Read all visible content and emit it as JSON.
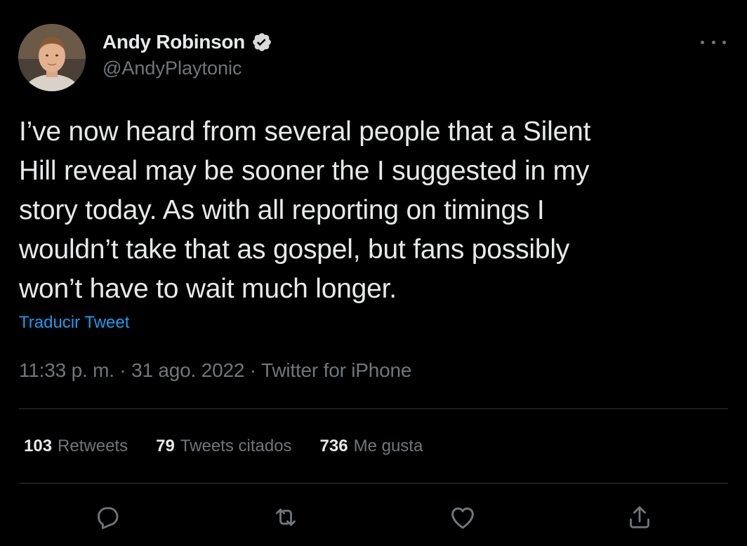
{
  "author": {
    "display_name": "Andy Robinson",
    "handle": "@AndyPlaytonic",
    "verified_icon": "verified-badge-icon"
  },
  "tweet": {
    "text": "I’ve now heard from several people that a Silent\nHill reveal may be sooner the I suggested in my\nstory today. As with all  reporting on timings I\nwouldn’t take that as gospel, but fans possibly\nwon’t have to wait much longer.",
    "translate_label": "Traducir Tweet",
    "time": "11:33 p. m.",
    "date": "31 ago. 2022",
    "source": "Twitter for iPhone",
    "separator": " · "
  },
  "stats": {
    "retweets": {
      "count": "103",
      "label": "Retweets"
    },
    "quotes": {
      "count": "79",
      "label": "Tweets citados"
    },
    "likes": {
      "count": "736",
      "label": "Me gusta"
    }
  },
  "actions": {
    "reply_icon": "reply-icon",
    "retweet_icon": "retweet-icon",
    "like_icon": "heart-icon",
    "share_icon": "share-icon"
  },
  "colors": {
    "background": "#000000",
    "text": "#e7e9ea",
    "secondary": "#71767b",
    "accent": "#1d9bf0",
    "divider": "#2f3336"
  }
}
